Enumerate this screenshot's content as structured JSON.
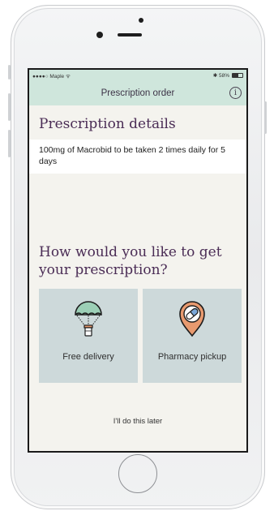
{
  "status_bar": {
    "carrier": "●●●●○ Maple ᯤ",
    "right_text": "✱ 58%",
    "battery_level_percent": 58
  },
  "nav": {
    "title": "Prescription order",
    "info_glyph": "i"
  },
  "details": {
    "heading": "Prescription details",
    "text": "100mg of Macrobid to be taken 2 times daily for 5 days"
  },
  "question": "How would you like to get your prescription?",
  "options": [
    {
      "label": "Free delivery",
      "icon": "parachute-delivery-icon"
    },
    {
      "label": "Pharmacy pickup",
      "icon": "location-pill-icon"
    }
  ],
  "later_link": "I'll do this later",
  "colors": {
    "header_bg": "#cfe6dc",
    "heading_purple": "#4a2c55",
    "screen_bg": "#f4f3ee",
    "card_bg": "#cdd9da",
    "pin_orange": "#e89a6f"
  }
}
